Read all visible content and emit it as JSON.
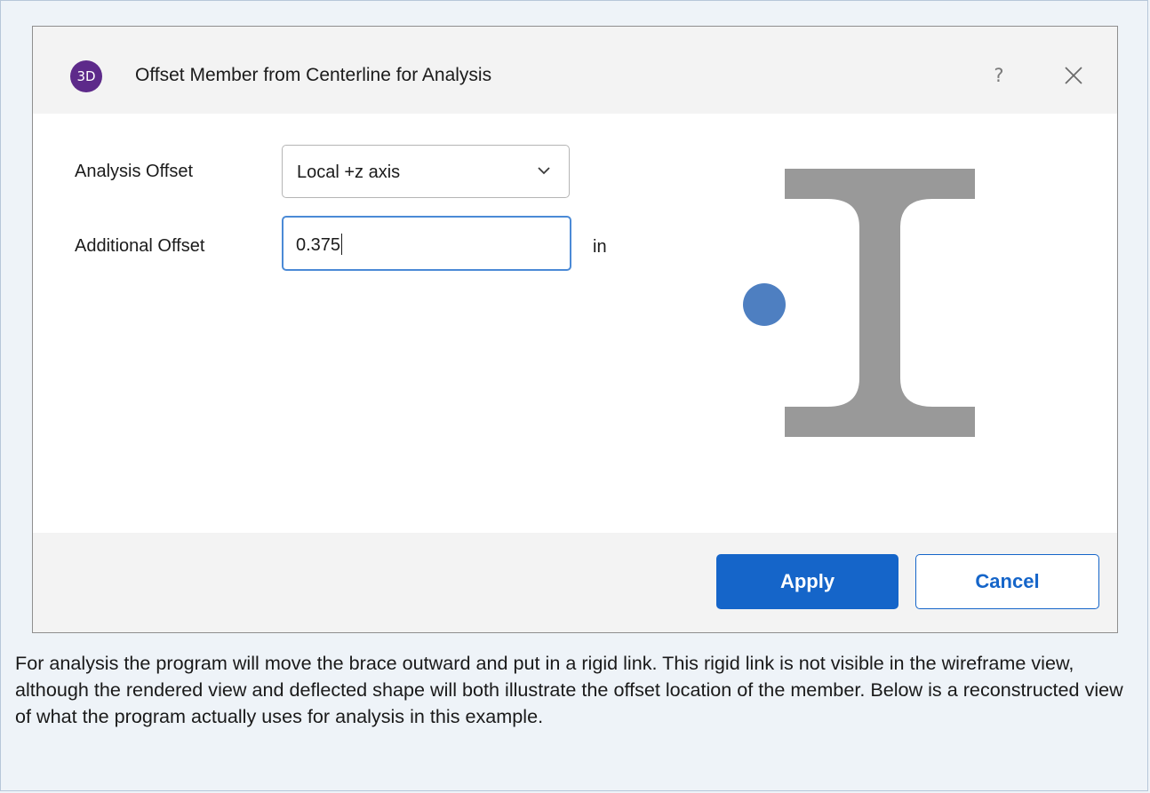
{
  "dialog": {
    "app_logo_text": "3D",
    "title": "Offset Member from Centerline for Analysis",
    "help_glyph": "?",
    "close_icon": "close-icon"
  },
  "form": {
    "analysis_offset_label": "Analysis Offset",
    "analysis_offset_value": "Local +z axis",
    "additional_offset_label": "Additional Offset",
    "additional_offset_value": "0.375",
    "additional_offset_unit": "in"
  },
  "diagram": {
    "icon": "i-beam-section-icon",
    "beam_color": "#999999",
    "point_icon": "offset-point-icon",
    "point_color": "#4e7fc1"
  },
  "buttons": {
    "apply_label": "Apply",
    "cancel_label": "Cancel"
  },
  "caption": "For analysis the program will move the brace outward and put in a rigid link. This rigid link is not visible in the wireframe view, although the rendered view and deflected shape will both illustrate the offset location of the member. Below is a reconstructed view of what the program actually uses for analysis in this example.",
  "colors": {
    "accent": "#1565c9",
    "focus_border": "#4b8ad6",
    "logo_bg": "#5d2a8a",
    "page_bg": "#eef3f8"
  }
}
